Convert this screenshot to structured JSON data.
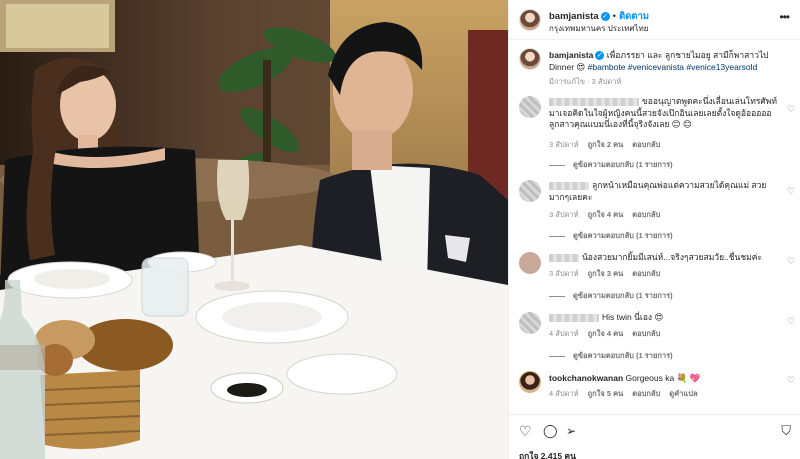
{
  "post": {
    "username": "bamjanista",
    "follow_label": "ติดตาม",
    "location": "กรุงเทพมหานคร ประเทศไทย",
    "caption_user": "bamjanista",
    "caption_text": "เพื่อภรรยา และ ลูกชายไมอยู สามีก็พาสาวไป Dinner 😍",
    "caption_tags": "#bambote #venicevanista #venice13yearsold",
    "caption_time": "มีการแก้ไข · 3 สัปดาห์"
  },
  "comments": [
    {
      "user": "",
      "text": "ขออนุญาตพูดคะนึ่งเลื่อนเล่นโทรศัพท์มาเจอคิดในใจผู้หญิงคนนี้สวยจังเป๊กอินเลยเลยตั้งใจดูอ้อออออลูกสาวคุณแบมนี่เองที่นี้จุริงจังเลย 😊 😊",
      "time": "3 สัปดาห์",
      "likes": "ถูกใจ 2 คน",
      "reply": "ตอบกลับ",
      "replies": "ดูข้อความตอบกลับ (1 รายการ)"
    },
    {
      "user": "",
      "text": "ลูกหน้าเหมือนคุณพ่อแต่ความสวยได้คุณแม่ สวยมากๆเลยคะ",
      "time": "3 สัปดาห์",
      "likes": "ถูกใจ 4 คน",
      "reply": "ตอบกลับ",
      "replies": "ดูข้อความตอบกลับ (1 รายการ)"
    },
    {
      "user": "",
      "text": "น้องสวยมากยิ้มมีเสน่ห์...จริงๆสวยสมวัย..ชื่นชมค่ะ",
      "time": "3 สัปดาห์",
      "likes": "ถูกใจ 3 คน",
      "reply": "ตอบกลับ",
      "replies": "ดูข้อความตอบกลับ (1 รายการ)"
    },
    {
      "user": "",
      "text": "His twin นี่เอง 😍",
      "time": "4 สัปดาห์",
      "likes": "ถูกใจ 4 คน",
      "reply": "ตอบกลับ",
      "replies": "ดูข้อความตอบกลับ (1 รายการ)"
    },
    {
      "user": "tookchanokwanan",
      "text": "Gorgeous ka 💐 💖",
      "time": "4 สัปดาห์",
      "likes": "ถูกใจ 5 คน",
      "reply": "ตอบกลับ",
      "translate": "ดูคำแปล"
    }
  ],
  "footer": {
    "likes": "ถูกใจ 2,415 คน"
  },
  "icons": [
    "heart-icon",
    "comment-icon",
    "share-icon",
    "bookmark-icon",
    "more-icon",
    "verified-icon"
  ],
  "colors": {
    "link": "#0095f6",
    "hashtag": "#00376b",
    "meta": "#8e8e8e"
  }
}
